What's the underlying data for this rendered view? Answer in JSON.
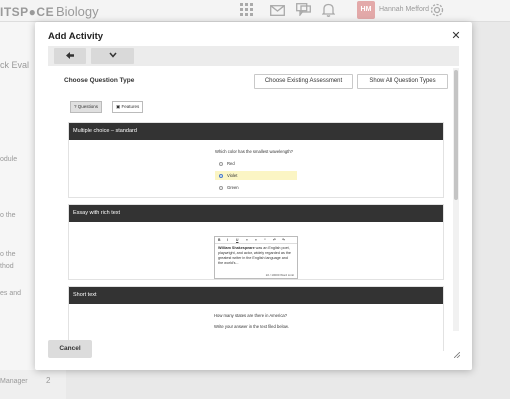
{
  "background": {
    "logo": "ITSP●CE",
    "course": "Biology",
    "user_initials": "HM",
    "user_name": "Hannah Mefford",
    "sidebar": [
      "ck Eval",
      "odule",
      "o the",
      "o the",
      "thod",
      "es and"
    ],
    "manager_label": "Manager",
    "manager_count": "2"
  },
  "modal": {
    "title": "Add Activity",
    "close_icon": "close-icon",
    "choose_label": "Choose Question Type",
    "choose_existing": "Choose Existing Assessment",
    "show_all": "Show All Question Types",
    "filters": [
      {
        "label": "Questions",
        "icon": "question-icon",
        "glyph": "?"
      },
      {
        "label": "Features",
        "icon": "image-icon",
        "glyph": "▣"
      }
    ],
    "cancel": "Cancel"
  },
  "cards": [
    {
      "title": "Multiple choice – standard",
      "question": "Which color has the smallest wavelength?",
      "options": [
        "Red",
        "Violet",
        "Green"
      ],
      "selected_index": 1
    },
    {
      "title": "Essay with rich text",
      "tools": [
        "B",
        "I",
        "U",
        "≡",
        "≡",
        "“",
        "↶",
        "↷"
      ],
      "essay_bold": "William Shakespeare",
      "essay_rest": " was an English poet, playwright, and actor, widely regarded as the greatest writer in the English language and the world's...",
      "word_limit": "22 / 10000 Word Limit"
    },
    {
      "title": "Short text",
      "question": "How many states are there in America?",
      "instruction": "Write your answer in the text filed below."
    }
  ],
  "colors": {
    "card_header": "#333333",
    "selected_option": "#fbf5c4",
    "radio_selected": "#4a7bc8"
  }
}
